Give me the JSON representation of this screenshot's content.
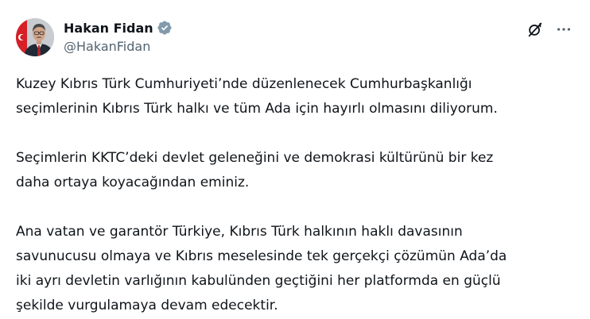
{
  "author": {
    "name": "Hakan Fidan",
    "handle": "@HakanFidan",
    "verified_badge": "verified-badge-icon",
    "badge_color": "#829aab"
  },
  "actions": {
    "grok_icon": "grok-icon",
    "more_icon": "more-options-icon"
  },
  "tweet": {
    "paragraphs": [
      {
        "lines": [
          "Kuzey Kıbrıs Türk Cumhuriyeti’nde düzenlenecek Cumhurbaşkanlığı",
          "seçimlerinin Kıbrıs Türk halkı ve tüm Ada için hayırlı olmasını diliyorum."
        ]
      },
      {
        "lines": [
          "Seçimlerin KKTC’deki devlet geleneğini ve demokrasi kültürünü bir kez",
          "daha ortaya koyacağından eminiz."
        ]
      },
      {
        "lines": [
          "Ana vatan ve garantör Türkiye, Kıbrıs Türk halkının haklı davasının",
          "savunucusu olmaya ve Kıbrıs meselesinde tek gerçekçi çözümün Ada’da",
          "iki ayrı devletin varlığının kabulünden geçtiğini her platformda en güçlü",
          "şekilde vurgulamaya devam edecektir."
        ]
      }
    ]
  },
  "colors": {
    "text": "#0f1419",
    "secondary": "#536471"
  }
}
